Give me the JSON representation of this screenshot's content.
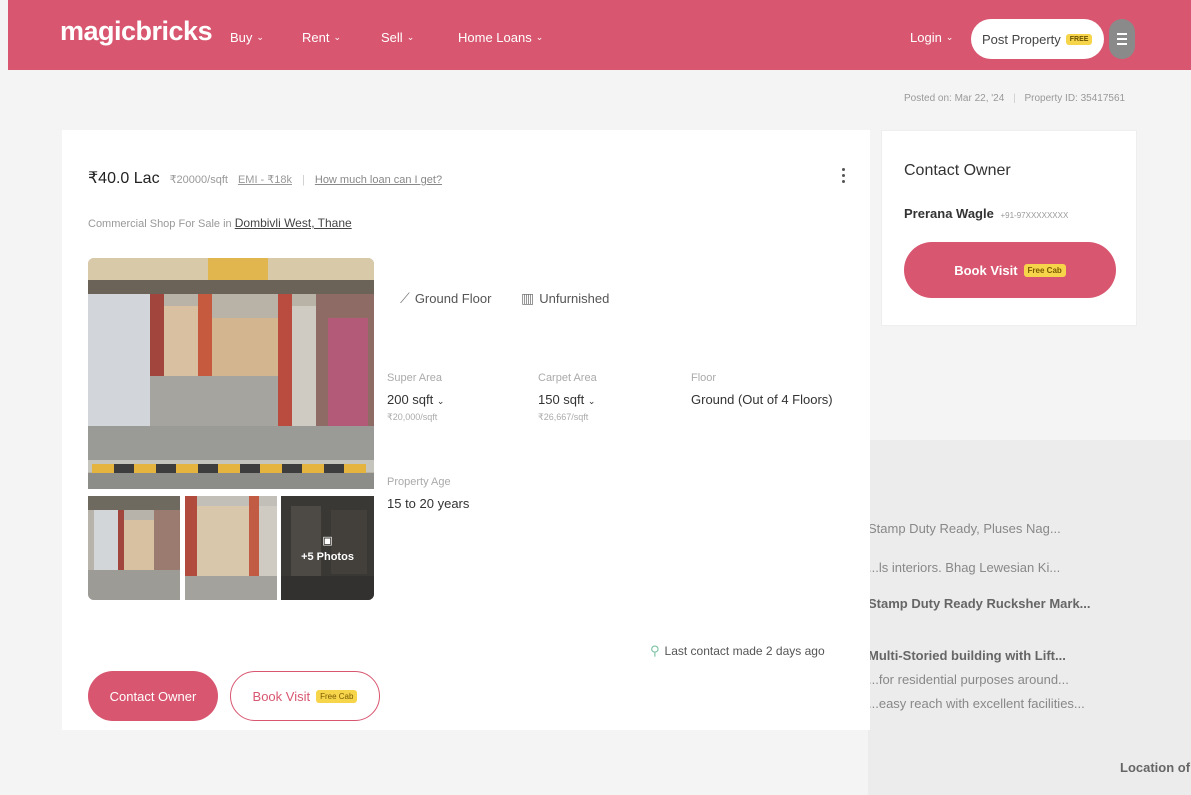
{
  "brand": {
    "logo": "magicbricks",
    "primary_color": "#d8566f",
    "tag_color": "#f7d54b"
  },
  "nav": {
    "items": [
      {
        "label": "Buy"
      },
      {
        "label": "Rent"
      },
      {
        "label": "Sell"
      },
      {
        "label": "Home Loans"
      }
    ],
    "login": "Login",
    "post_property": "Post Property",
    "post_property_tag": "FREE"
  },
  "listing": {
    "price": "₹40.0 Lac",
    "price_per_sqft": "₹20000/sqft",
    "emi": "EMI - ₹18k",
    "separator": "|",
    "loan_link": "How much loan can I get?",
    "subtitle_prefix": "Commercial Shop For Sale in",
    "location": "Dombivli West, Thane",
    "more_photos": "+5 Photos",
    "features": [
      {
        "icon": "stairs-icon",
        "label": "Ground Floor"
      },
      {
        "icon": "wardrobe-icon",
        "label": "Unfurnished"
      }
    ],
    "specs": {
      "super_area": {
        "label": "Super Area",
        "value": "200 sqft",
        "sub": "₹20,000/sqft"
      },
      "carpet_area": {
        "label": "Carpet Area",
        "value": "150 sqft",
        "sub": "₹26,667/sqft"
      },
      "floor": {
        "label": "Floor",
        "value": "Ground (Out of 4 Floors)"
      },
      "property_age": {
        "label": "Property Age",
        "value": "15 to 20 years"
      }
    },
    "contact_button": "Contact Owner",
    "book_visit_button": "Book Visit",
    "free_cab_tag": "Free Cab",
    "last_contact": "Last contact made 2 days ago"
  },
  "sidebar": {
    "posted_on": "Posted on: Mar 22, '24",
    "property_id": "Property ID: 35417561",
    "contact_title": "Contact Owner",
    "owner_name": "Prerana Wagle",
    "owner_phone": "+91-97XXXXXXXX",
    "book_visit": "Book Visit",
    "free_cab_tag": "Free Cab"
  },
  "background_text": {
    "line1": "Stamp Duty Ready, Pluses Nag...",
    "line2": "...ls interiors. Bhag Lewesian Ki...",
    "line3": "Stamp Duty Ready Rucksher Mark...",
    "line4": "Multi-Storied building with Lift...",
    "line5": "...for residential purposes around...",
    "line6": "...easy reach with excellent facilities...",
    "line7": "Location of Flat / Commercial unit is..."
  }
}
